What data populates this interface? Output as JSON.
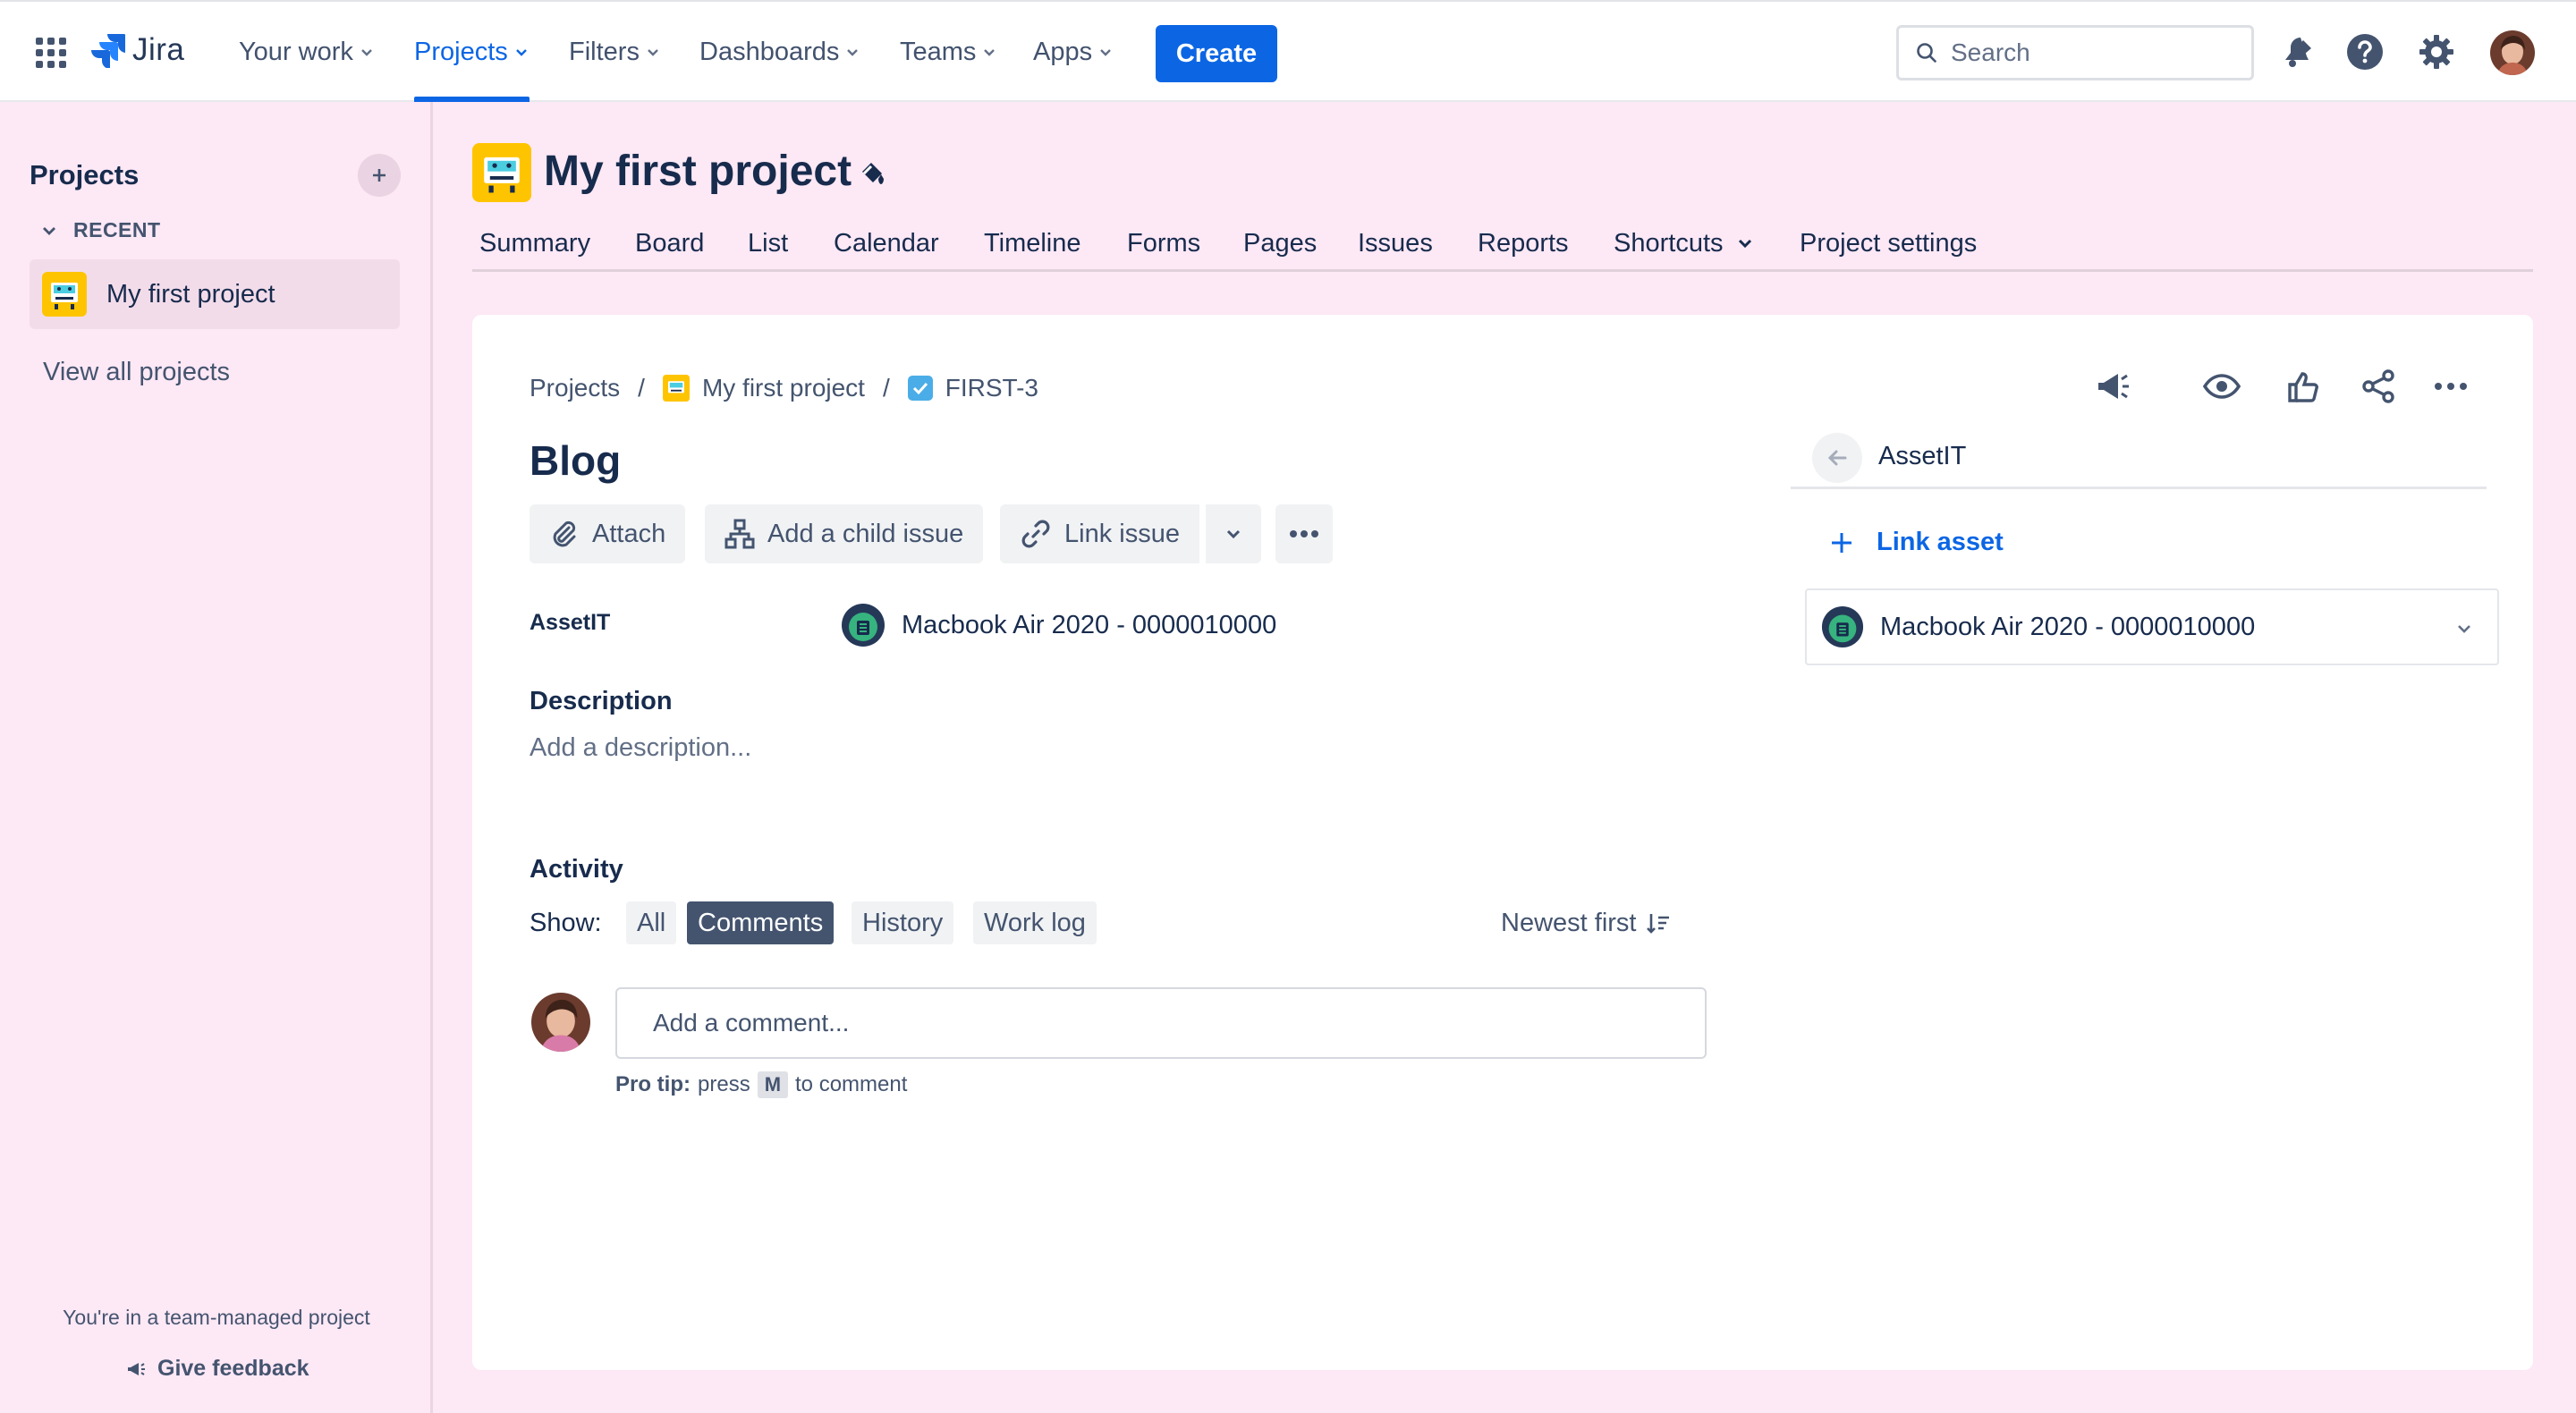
{
  "app": {
    "logo_text": "Jira"
  },
  "nav": {
    "items": [
      {
        "label": "Your work"
      },
      {
        "label": "Projects"
      },
      {
        "label": "Filters"
      },
      {
        "label": "Dashboards"
      },
      {
        "label": "Teams"
      },
      {
        "label": "Apps"
      }
    ],
    "active": "Projects",
    "create_label": "Create",
    "search_placeholder": "Search"
  },
  "sidebar": {
    "title": "Projects",
    "recent_label": "RECENT",
    "recent_project": "My first project",
    "view_all": "View all projects",
    "footer_text": "You're in a team-managed project",
    "feedback": "Give feedback"
  },
  "project": {
    "title": "My first project",
    "tabs": [
      {
        "label": "Summary"
      },
      {
        "label": "Board"
      },
      {
        "label": "List"
      },
      {
        "label": "Calendar"
      },
      {
        "label": "Timeline"
      },
      {
        "label": "Forms"
      },
      {
        "label": "Pages"
      },
      {
        "label": "Issues"
      },
      {
        "label": "Reports"
      },
      {
        "label": "Shortcuts"
      },
      {
        "label": "Project settings"
      }
    ]
  },
  "issue": {
    "breadcrumbs": [
      "Projects",
      "My first project",
      "FIRST-3"
    ],
    "separator": "/",
    "title": "Blog",
    "actions": {
      "attach": "Attach",
      "add_child": "Add a child issue",
      "link_issue": "Link issue"
    },
    "field": {
      "label": "AssetIT",
      "value": "Macbook Air 2020 - 0000010000"
    },
    "description_label": "Description",
    "description_placeholder": "Add a description...",
    "activity": {
      "title": "Activity",
      "show_label": "Show:",
      "filters": [
        "All",
        "Comments",
        "History",
        "Work log"
      ],
      "selected_filter": "Comments",
      "sort_label": "Newest first",
      "comment_placeholder": "Add a comment...",
      "protip_bold": "Pro tip:",
      "protip_press": "press",
      "protip_key": "M",
      "protip_suffix": "to comment"
    }
  },
  "panel": {
    "title": "AssetIT",
    "link_asset": "Link asset",
    "asset": "Macbook Air 2020 - 0000010000"
  },
  "colors": {
    "brand_blue": "#0c66e4",
    "sidebar_bg": "#fde8f5",
    "text_primary": "#172b4d",
    "text_subtle": "#44546f"
  },
  "icons": [
    "app-switcher-icon",
    "jira-logo-icon",
    "search-icon",
    "notifications-icon",
    "help-icon",
    "settings-icon",
    "paint-icon",
    "attach-icon",
    "child-issue-icon",
    "link-icon",
    "more-icon",
    "announce-icon",
    "watch-icon",
    "like-icon",
    "share-icon",
    "arrow-left-icon",
    "plus-icon",
    "chevron-down-icon",
    "sort-icon"
  ]
}
